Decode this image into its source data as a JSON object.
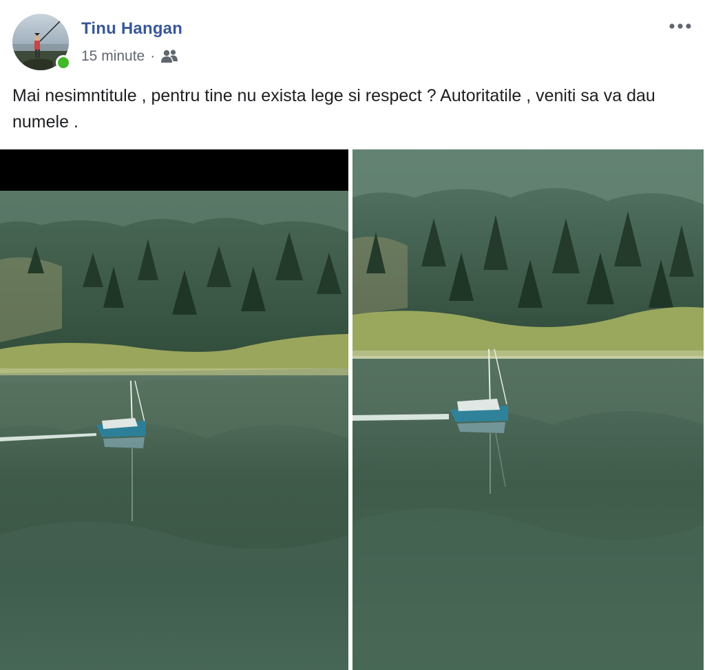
{
  "post": {
    "author": "Tinu Hangan",
    "time": "15 minute",
    "separator": "·",
    "audience_icon": "friends-icon",
    "more_icon": "more-options-icon",
    "text": "Mai nesimntitule , pentru tine nu exista lege si respect ? Autoritatile , veniti sa va dau numele .",
    "online": true
  },
  "photos": [
    {
      "subject": "lake-sailboat-photo-1"
    },
    {
      "subject": "lake-sailboat-photo-2"
    }
  ],
  "colors": {
    "author_link": "#385898",
    "meta": "#616770",
    "online": "#42b72a",
    "text": "#1c1e21"
  }
}
